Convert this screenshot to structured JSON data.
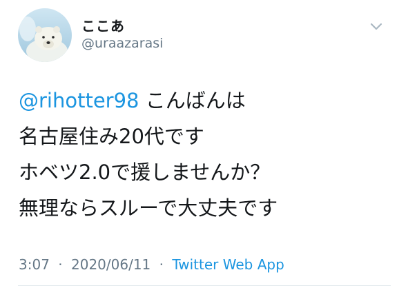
{
  "user": {
    "display_name": "ここあ",
    "handle": "@uraazarasi"
  },
  "tweet": {
    "mention": "@rihotter98",
    "line1_rest": " こんばんは",
    "line2": "名古屋住み20代です",
    "line3": "ホベツ2.0で援しませんか？",
    "line4": "無理ならスルーで大丈夫です"
  },
  "meta": {
    "time": "3:07",
    "date": "2020/06/11",
    "separator": "·",
    "source": "Twitter Web App"
  },
  "icons": {
    "avatar": "polar-bear-avatar",
    "menu": "chevron-down-icon"
  },
  "colors": {
    "link": "#1b95e0",
    "secondary": "#657786",
    "text": "#14171a"
  }
}
